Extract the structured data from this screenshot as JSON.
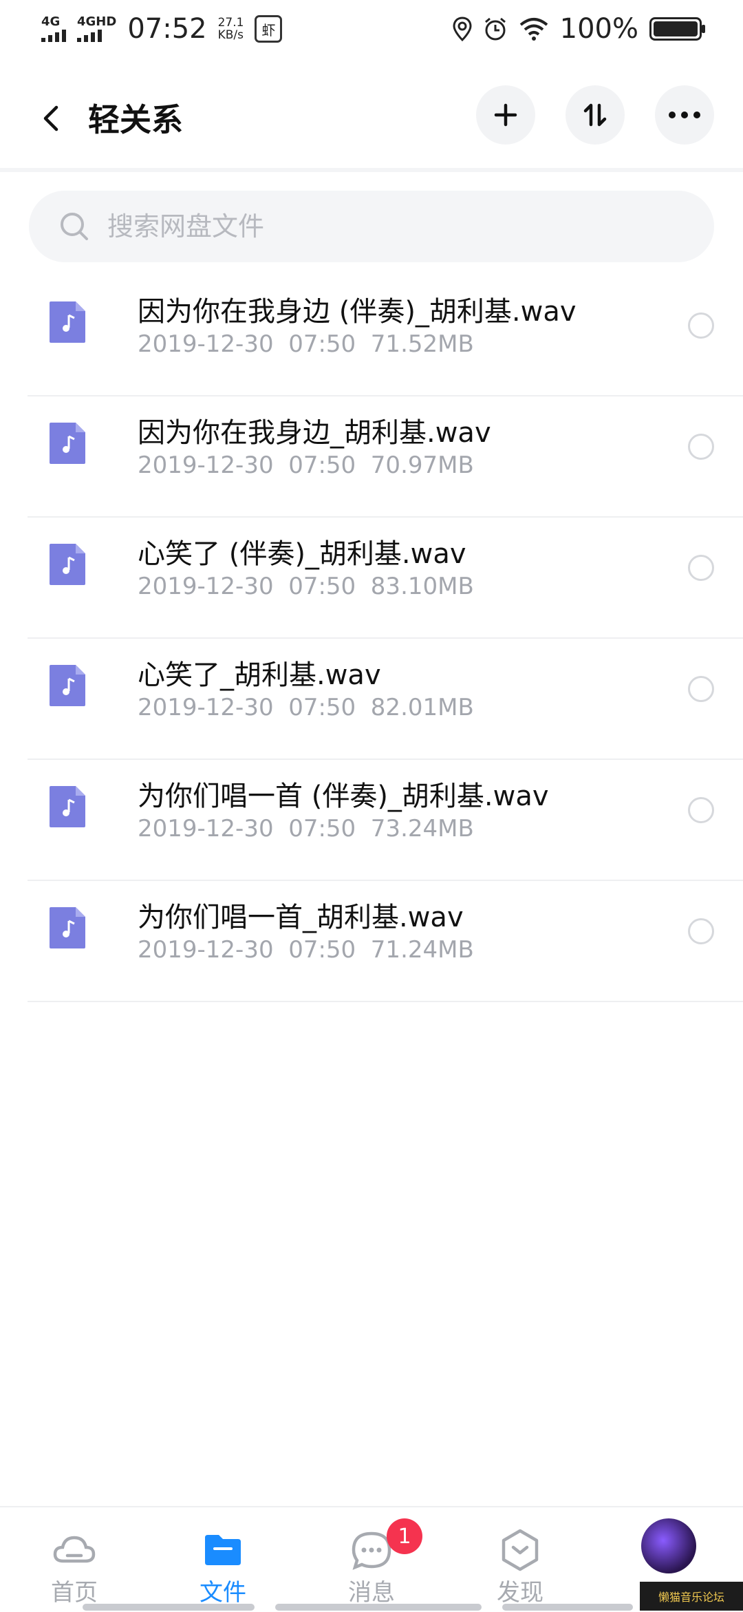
{
  "status_bar": {
    "network1": "4G",
    "network2": "4GHD",
    "time": "07:52",
    "speed_value": "27.1",
    "speed_unit": "KB/s",
    "app_icon_char": "虾",
    "battery": "100%"
  },
  "header": {
    "title": "轻关系"
  },
  "search": {
    "placeholder": "搜索网盘文件"
  },
  "files": [
    {
      "name": "因为你在我身边 (伴奏)_胡利基.wav",
      "meta": "2019-12-30  07:50  71.52MB"
    },
    {
      "name": "因为你在我身边_胡利基.wav",
      "meta": "2019-12-30  07:50  70.97MB"
    },
    {
      "name": "心笑了 (伴奏)_胡利基.wav",
      "meta": "2019-12-30  07:50  83.10MB"
    },
    {
      "name": "心笑了_胡利基.wav",
      "meta": "2019-12-30  07:50  82.01MB"
    },
    {
      "name": "为你们唱一首 (伴奏)_胡利基.wav",
      "meta": "2019-12-30  07:50  73.24MB"
    },
    {
      "name": "为你们唱一首_胡利基.wav",
      "meta": "2019-12-30  07:50  71.24MB"
    }
  ],
  "tabs": [
    {
      "label": "首页",
      "icon": "cloud-icon"
    },
    {
      "label": "文件",
      "icon": "folder-icon"
    },
    {
      "label": "消息",
      "icon": "chat-icon"
    },
    {
      "label": "发现",
      "icon": "discover-icon"
    }
  ],
  "messages_badge": "1",
  "watermark": "懒猫音乐论坛",
  "colors": {
    "accent": "#1a8cff",
    "file_icon": "#7b7fe0",
    "badge": "#f5334f"
  }
}
